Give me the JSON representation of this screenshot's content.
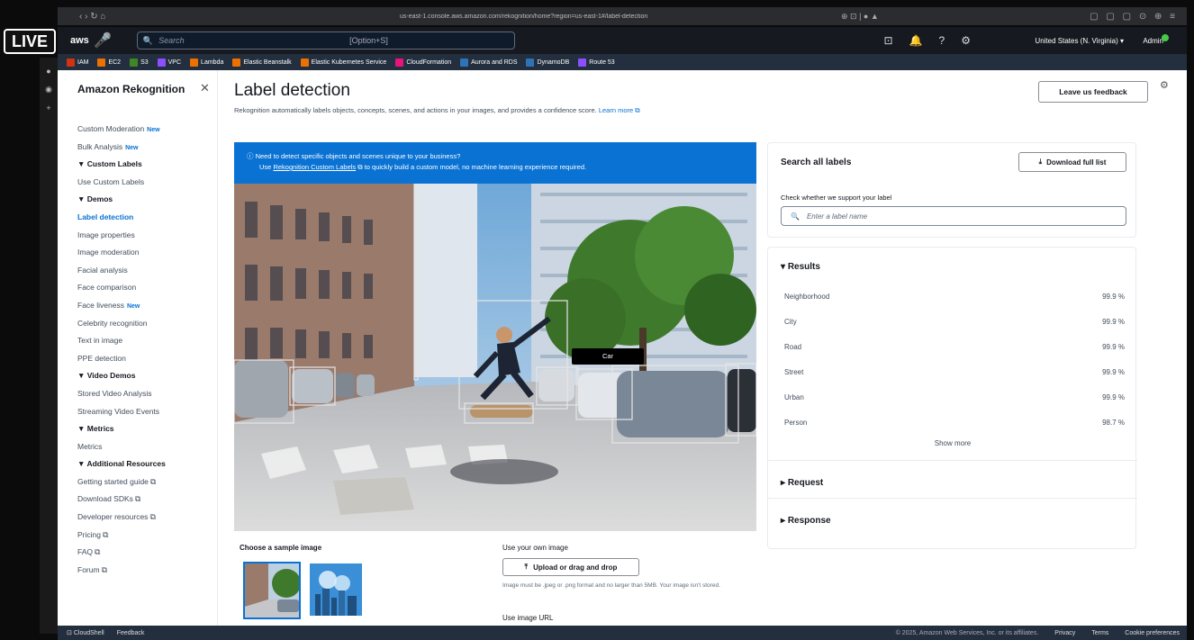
{
  "browser": {
    "nav": "‹ › ↻ ⌂",
    "url": "us-east-1.console.aws.amazon.com/rekognition/home?region=us-east-1#/label-detection",
    "mid_icons": "⊕ ⊡ | ● ▲",
    "right_icons": "▢ ▢ ▢ ⊙ ⊕ ≡"
  },
  "live_badge": "LIVE",
  "topnav": {
    "logo": "aws",
    "search_placeholder": "Search",
    "search_shortcut": "[Option+S]",
    "region": "United States (N. Virginia) ▾",
    "user": "Admin"
  },
  "favorites": [
    {
      "label": "IAM",
      "color": "#d13212"
    },
    {
      "label": "EC2",
      "color": "#ed7100"
    },
    {
      "label": "S3",
      "color": "#3f8624"
    },
    {
      "label": "VPC",
      "color": "#8c4fff"
    },
    {
      "label": "Lambda",
      "color": "#ed7100"
    },
    {
      "label": "Elastic Beanstalk",
      "color": "#ed7100"
    },
    {
      "label": "Elastic Kubernetes Service",
      "color": "#ed7100"
    },
    {
      "label": "CloudFormation",
      "color": "#e7157b"
    },
    {
      "label": "Aurora and RDS",
      "color": "#2e73b8"
    },
    {
      "label": "DynamoDB",
      "color": "#2e73b8"
    },
    {
      "label": "Route 53",
      "color": "#8c4fff"
    }
  ],
  "sidebar": {
    "title": "Amazon Rekognition",
    "items": [
      {
        "label": "Custom Moderation",
        "kind": "item",
        "new": "New"
      },
      {
        "label": "Bulk Analysis",
        "kind": "item",
        "new": "New"
      },
      {
        "label": "▼ Custom Labels",
        "kind": "head"
      },
      {
        "label": "Use Custom Labels",
        "kind": "item"
      },
      {
        "label": "▼ Demos",
        "kind": "head"
      },
      {
        "label": "Label detection",
        "kind": "active"
      },
      {
        "label": "Image properties",
        "kind": "item"
      },
      {
        "label": "Image moderation",
        "kind": "item"
      },
      {
        "label": "Facial analysis",
        "kind": "item"
      },
      {
        "label": "Face comparison",
        "kind": "item"
      },
      {
        "label": "Face liveness",
        "kind": "item",
        "new": "New"
      },
      {
        "label": "Celebrity recognition",
        "kind": "item"
      },
      {
        "label": "Text in image",
        "kind": "item"
      },
      {
        "label": "PPE detection",
        "kind": "item"
      },
      {
        "label": "▼ Video Demos",
        "kind": "head"
      },
      {
        "label": "Stored Video Analysis",
        "kind": "item"
      },
      {
        "label": "Streaming Video Events",
        "kind": "item"
      },
      {
        "label": "▼ Metrics",
        "kind": "head"
      },
      {
        "label": "Metrics",
        "kind": "item"
      },
      {
        "label": "▼ Additional Resources",
        "kind": "head"
      },
      {
        "label": "Getting started guide",
        "kind": "item",
        "ext": true
      },
      {
        "label": "Download SDKs",
        "kind": "item",
        "ext": true
      },
      {
        "label": "Developer resources",
        "kind": "item",
        "ext": true
      },
      {
        "label": "Pricing",
        "kind": "item",
        "ext": true
      },
      {
        "label": "FAQ",
        "kind": "item",
        "ext": true
      },
      {
        "label": "Forum",
        "kind": "item",
        "ext": true
      }
    ]
  },
  "main": {
    "title": "Label detection",
    "description": "Rekognition automatically labels objects, concepts, scenes, and actions in your images, and provides a confidence score.",
    "learn_more": "Learn more",
    "feedback_button": "Leave us feedback",
    "banner_line1": "Need to detect specific objects and scenes unique to your business?",
    "banner_use": "Use",
    "banner_link": "Rekognition Custom Labels",
    "banner_line2": "to quickly build a custom model, no machine learning experience required.",
    "car_label": "Car",
    "sample_title": "Choose a sample image",
    "own_image_title": "Use your own image",
    "upload_button": "Upload or drag and drop",
    "upload_hint": "Image must be .jpeg or .png format and no larger than 5MB. Your image isn't stored.",
    "url_title": "Use image URL"
  },
  "labels_panel": {
    "title": "Search all labels",
    "download_button": "Download full list",
    "check_label": "Check whether we support your label",
    "input_placeholder": "Enter a label name",
    "results_title": "Results",
    "results": [
      {
        "name": "Neighborhood",
        "score": "99.9 %"
      },
      {
        "name": "City",
        "score": "99.9 %"
      },
      {
        "name": "Road",
        "score": "99.9 %"
      },
      {
        "name": "Street",
        "score": "99.9 %"
      },
      {
        "name": "Urban",
        "score": "99.9 %"
      },
      {
        "name": "Person",
        "score": "98.7 %"
      }
    ],
    "show_more": "Show more",
    "request_title": "Request",
    "response_title": "Response"
  },
  "footer": {
    "cloudshell": "CloudShell",
    "feedback": "Feedback",
    "copyright": "© 2025, Amazon Web Services, Inc. or its affiliates.",
    "privacy": "Privacy",
    "terms": "Terms",
    "cookies": "Cookie preferences"
  }
}
